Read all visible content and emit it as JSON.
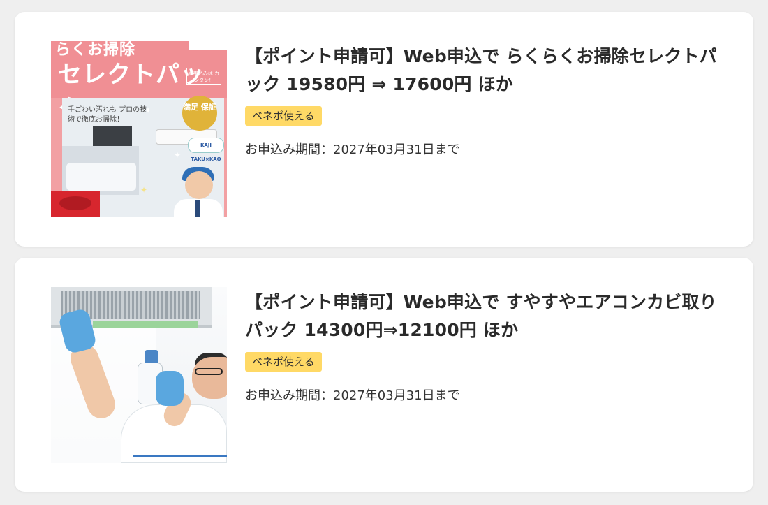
{
  "cards": [
    {
      "title": "【ポイント申請可】Web申込で らくらくお掃除セレクトパック 19580円 ⇒ 17600円 ほか",
      "badge": "ベネポ使える",
      "period": "お申込み期間：2027年03月31日まで",
      "thumbnail": {
        "heading_small": "らくお掃除",
        "heading": "セレクトパック",
        "tag": "お申込みは カンタン！",
        "caption": "手ごわい汚れも プロの技術で徹底お掃除！",
        "seal": "満足 保証",
        "logo": "KAJI TAKU×KAO"
      }
    },
    {
      "title": "【ポイント申請可】Web申込で すやすやエアコンカビ取りパック 14300円⇒12100円 ほか",
      "badge": "ベネポ使える",
      "period": "お申込み期間：2027年03月31日まで"
    }
  ],
  "colors": {
    "badge_bg": "#ffd966",
    "page_bg": "#efefef",
    "card_bg": "#ffffff"
  }
}
